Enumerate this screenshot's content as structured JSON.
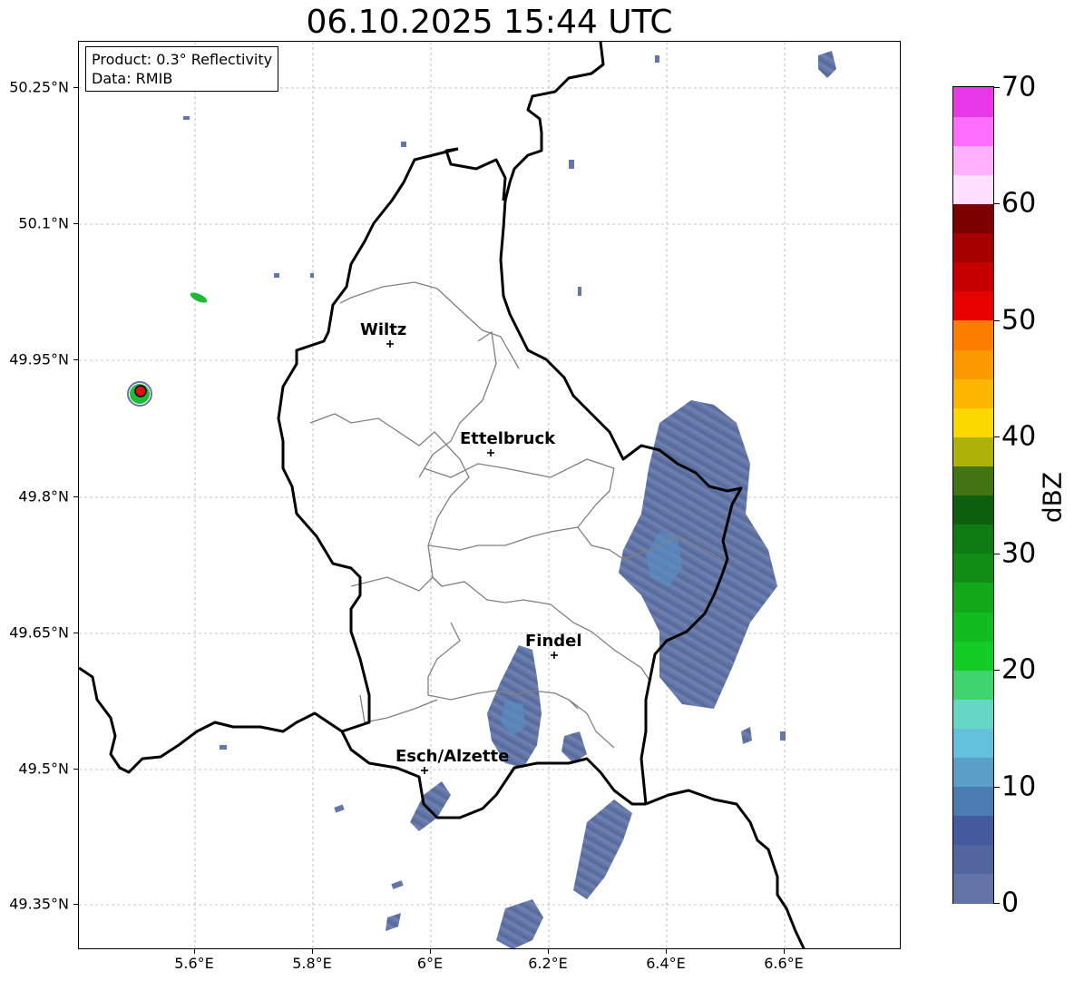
{
  "title": "06.10.2025 15:44 UTC",
  "info": {
    "product": "Product: 0.3° Reflectivity",
    "source": "Data: RMIB"
  },
  "axes": {
    "lat_labels": [
      "50.25°N",
      "50.1°N",
      "49.95°N",
      "49.8°N",
      "49.65°N",
      "49.5°N",
      "49.35°N"
    ],
    "lon_labels": [
      "5.6°E",
      "5.8°E",
      "6°E",
      "6.2°E",
      "6.4°E",
      "6.6°E"
    ]
  },
  "cities": [
    {
      "name": "Wiltz",
      "lon": 5.93,
      "lat": 49.966
    },
    {
      "name": "Ettelbruck",
      "lon": 6.1,
      "lat": 49.847
    },
    {
      "name": "Findel",
      "lon": 6.21,
      "lat": 49.626
    },
    {
      "name": "Esch/Alzette",
      "lon": 5.99,
      "lat": 49.497
    }
  ],
  "radar_site": {
    "lon": 5.505,
    "lat": 49.914
  },
  "colorbar": {
    "label": "dBZ",
    "ticks": [
      "0",
      "10",
      "20",
      "30",
      "40",
      "50",
      "60",
      "70"
    ],
    "colors": [
      "#6474a6",
      "#52659f",
      "#435b9e",
      "#4a7bb2",
      "#5a9fc8",
      "#64c1de",
      "#64d8c4",
      "#3fd46e",
      "#14cc26",
      "#12bb1f",
      "#13a81a",
      "#118c14",
      "#0e7b12",
      "#0b5f0d",
      "#437413",
      "#adb108",
      "#fad800",
      "#fbb600",
      "#fb9a00",
      "#fc7d00",
      "#e60000",
      "#c60000",
      "#a50000",
      "#7d0000",
      "#ffe0ff",
      "#ffb1ff",
      "#ff6eff",
      "#e838e8"
    ]
  },
  "colors": {
    "echo": "#5c6fa3",
    "echo_light": "#4d84bf",
    "echo_highlight": "#5fa8cf",
    "radar_dot": "#e11010"
  }
}
